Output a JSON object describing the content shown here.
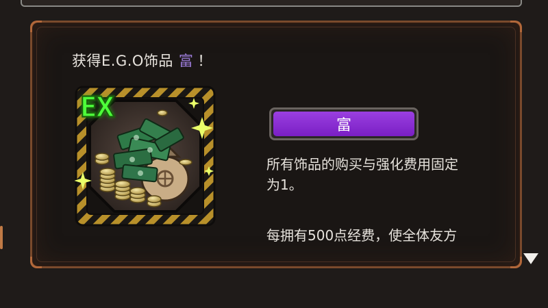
{
  "dialog": {
    "headline_prefix": "获得E.G.O饰品",
    "item_name": "富",
    "headline_suffix": "！",
    "badge": "EX",
    "banner_label": "富",
    "description_lines": [
      "所有饰品的购买与强化费用固定",
      "为1。",
      "每拥有500点经费，使全体友方"
    ],
    "icon": "money-pile-icon",
    "more_indicator": "down-triangle-icon"
  },
  "colors": {
    "panel_border": "#7a4a2c",
    "item_name": "#9a7ad6",
    "banner": "#8a2fd6",
    "ex_badge": "#4dff3a",
    "hazard_stripe": "#b8902a"
  }
}
